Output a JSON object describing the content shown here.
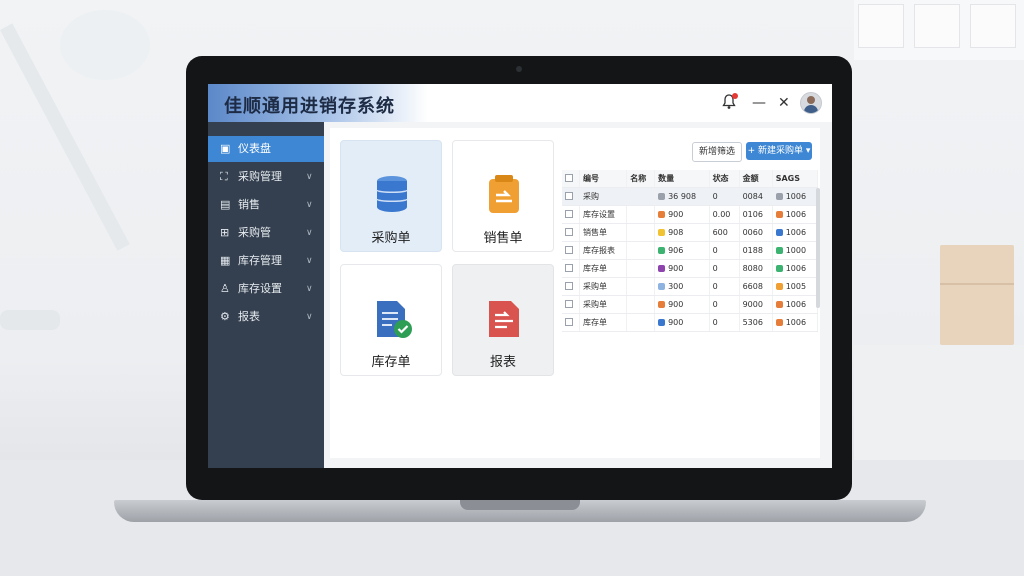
{
  "app": {
    "title": "佳顺通用进销存系统"
  },
  "titlebar": {
    "bell_icon": "bell-icon",
    "minimize": "—",
    "close": "✕"
  },
  "sidebar": {
    "items": [
      {
        "label": "仪表盘",
        "icon": "home-icon",
        "active": true
      },
      {
        "label": "采购管理",
        "icon": "cart-icon"
      },
      {
        "label": "销售",
        "icon": "folder-icon"
      },
      {
        "label": "采购管",
        "icon": "grid-icon"
      },
      {
        "label": "库存管理",
        "icon": "warehouse-icon"
      },
      {
        "label": "库存设置",
        "icon": "user-icon"
      },
      {
        "label": "报表",
        "icon": "gear-icon"
      }
    ]
  },
  "tiles": [
    {
      "label": "采购单",
      "icon": "database-icon",
      "color": "#3a78d0"
    },
    {
      "label": "销售单",
      "icon": "sales-doc-icon",
      "color": "#f0a033"
    },
    {
      "label": "库存单",
      "icon": "inventory-doc-icon",
      "color": "#3a6fc0"
    },
    {
      "label": "报表",
      "icon": "report-doc-icon",
      "color": "#d9534f"
    }
  ],
  "toolbar": {
    "btn_secondary": "新增筛选",
    "btn_primary": "+ 新建采购单 ▾"
  },
  "table": {
    "headers": [
      "编号",
      "名称",
      "数量",
      "状态",
      "金额",
      "SAGS"
    ],
    "rows": [
      {
        "name": "采购",
        "qty": "36 908",
        "status": "0",
        "amount": "0084",
        "total": "1006",
        "dot": "#9aa1aa",
        "mark": "#9aa1aa"
      },
      {
        "name": "库存设置",
        "qty": "900",
        "status": "0.00",
        "amount": "0106",
        "total": "1006",
        "dot": "#e67e3a",
        "mark": "#e67e3a"
      },
      {
        "name": "销售单",
        "qty": "908",
        "status": "600",
        "amount": "0060",
        "total": "1006",
        "dot": "#f1c232",
        "mark": "#3a78d0"
      },
      {
        "name": "库存报表",
        "qty": "906",
        "status": "0",
        "amount": "0188",
        "total": "1000",
        "dot": "#3cb371",
        "mark": "#3cb371"
      },
      {
        "name": "库存单",
        "qty": "900",
        "status": "0",
        "amount": "8080",
        "total": "1006",
        "dot": "#8e44ad",
        "mark": "#3cb371"
      },
      {
        "name": "采购单",
        "qty": "300",
        "status": "0",
        "amount": "6608",
        "total": "1005",
        "dot": "#8fb3e0",
        "mark": "#f0a033"
      },
      {
        "name": "采购单",
        "qty": "900",
        "status": "0",
        "amount": "9000",
        "total": "1006",
        "dot": "#e67e3a",
        "mark": "#e67e3a"
      },
      {
        "name": "库存单",
        "qty": "900",
        "status": "0",
        "amount": "5306",
        "total": "1006",
        "dot": "#3a78d0",
        "mark": "#e67e3a"
      }
    ]
  }
}
